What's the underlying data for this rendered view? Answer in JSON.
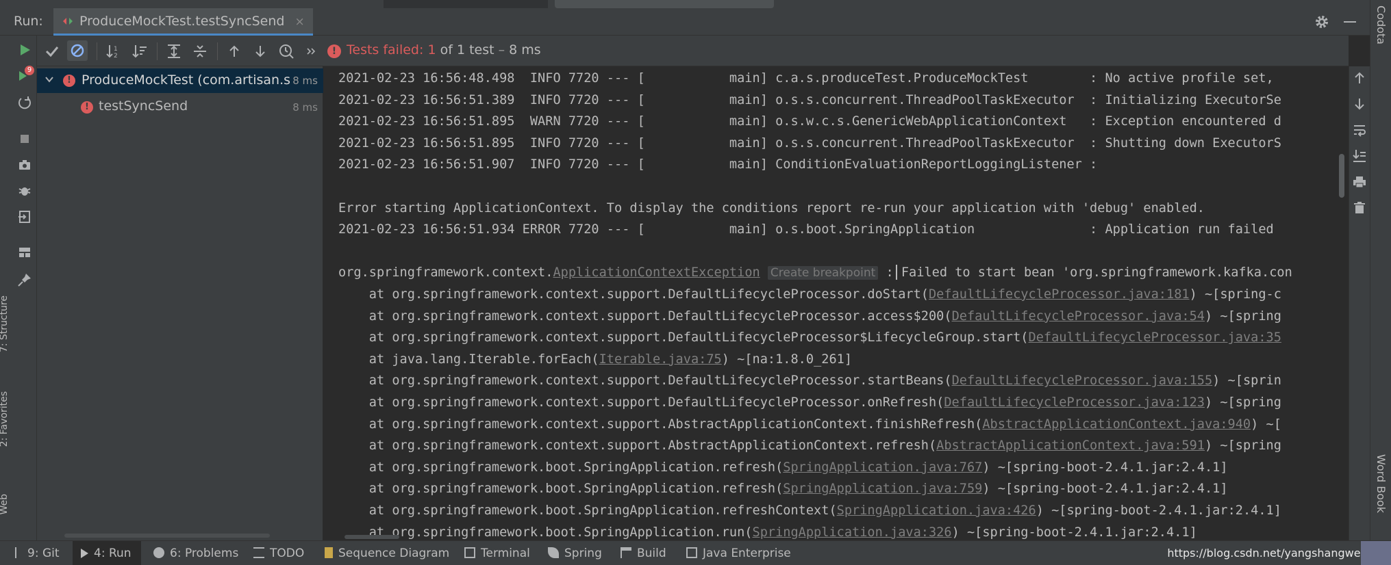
{
  "run_header": {
    "label": "Run:",
    "tab_title": "ProduceMockTest.testSyncSend",
    "tab_close": "×"
  },
  "side_labels": {
    "right_top": "Codota",
    "right_bottom": "Word Book",
    "left_structure": "7: Structure",
    "left_favorites": "2: Favorites",
    "left_web": "Web",
    "left_badge": "9"
  },
  "status": {
    "failed": "Tests failed:",
    "count": "1",
    "of_text": "of 1 test",
    "sep": "–",
    "time": "8 ms"
  },
  "tree": {
    "root_label": "ProduceMockTest (com.artisan.spring",
    "root_time": "8 ms",
    "child_label": "testSyncSend",
    "child_time": "8 ms"
  },
  "console_lines": [
    {
      "text": "2021-02-23 16:56:48.498  INFO 7720 --- [           main] c.a.s.produceTest.ProduceMockTest        : No active profile set,"
    },
    {
      "text": "2021-02-23 16:56:51.389  INFO 7720 --- [           main] o.s.s.concurrent.ThreadPoolTaskExecutor  : Initializing ExecutorSe"
    },
    {
      "text": "2021-02-23 16:56:51.895  WARN 7720 --- [           main] o.s.w.c.s.GenericWebApplicationContext   : Exception encountered d"
    },
    {
      "text": "2021-02-23 16:56:51.895  INFO 7720 --- [           main] o.s.s.concurrent.ThreadPoolTaskExecutor  : Shutting down ExecutorS"
    },
    {
      "text": "2021-02-23 16:56:51.907  INFO 7720 --- [           main] ConditionEvaluationReportLoggingListener :"
    },
    {
      "text": ""
    },
    {
      "text": "Error starting ApplicationContext. To display the conditions report re-run your application with 'debug' enabled."
    },
    {
      "text": "2021-02-23 16:56:51.934 ERROR 7720 --- [           main] o.s.boot.SpringApplication               : Application run failed"
    },
    {
      "text": ""
    },
    {
      "pre": "org.springframework.context.",
      "link": "ApplicationContextException",
      "hint": "Create breakpoint",
      "post": " : Failed to start bean 'org.springframework.kafka.con"
    },
    {
      "pre": "    at org.springframework.context.support.DefaultLifecycleProcessor.doStart(",
      "link": "DefaultLifecycleProcessor.java:181",
      "post": ") ~[spring-c"
    },
    {
      "pre": "    at org.springframework.context.support.DefaultLifecycleProcessor.access$200(",
      "link": "DefaultLifecycleProcessor.java:54",
      "post": ") ~[spring"
    },
    {
      "pre": "    at org.springframework.context.support.DefaultLifecycleProcessor$LifecycleGroup.start(",
      "link": "DefaultLifecycleProcessor.java:35",
      "post": ""
    },
    {
      "pre": "    at java.lang.Iterable.forEach(",
      "link": "Iterable.java:75",
      "post": ") ~[na:1.8.0_261]"
    },
    {
      "pre": "    at org.springframework.context.support.DefaultLifecycleProcessor.startBeans(",
      "link": "DefaultLifecycleProcessor.java:155",
      "post": ") ~[sprin"
    },
    {
      "pre": "    at org.springframework.context.support.DefaultLifecycleProcessor.onRefresh(",
      "link": "DefaultLifecycleProcessor.java:123",
      "post": ") ~[spring"
    },
    {
      "pre": "    at org.springframework.context.support.AbstractApplicationContext.finishRefresh(",
      "link": "AbstractApplicationContext.java:940",
      "post": ") ~["
    },
    {
      "pre": "    at org.springframework.context.support.AbstractApplicationContext.refresh(",
      "link": "AbstractApplicationContext.java:591",
      "post": ") ~[spring"
    },
    {
      "pre": "    at org.springframework.boot.SpringApplication.refresh(",
      "link": "SpringApplication.java:767",
      "post": ") ~[spring-boot-2.4.1.jar:2.4.1]"
    },
    {
      "pre": "    at org.springframework.boot.SpringApplication.refresh(",
      "link": "SpringApplication.java:759",
      "post": ") ~[spring-boot-2.4.1.jar:2.4.1]"
    },
    {
      "pre": "    at org.springframework.boot.SpringApplication.refreshContext(",
      "link": "SpringApplication.java:426",
      "post": ") ~[spring-boot-2.4.1.jar:2.4.1]"
    },
    {
      "pre": "    at org.springframework.boot.SpringApplication.run(",
      "link": "SpringApplication.java:326",
      "post": ") ~[spring-boot-2.4.1.jar:2.4.1]"
    }
  ],
  "bottom_bar": {
    "git": "9: Git",
    "run": "4: Run",
    "problems": "6: Problems",
    "todo": "TODO",
    "sequence": "Sequence Diagram",
    "terminal": "Terminal",
    "spring": "Spring",
    "build": "Build",
    "java_enterprise": "Java Enterprise",
    "watermark": "https://blog.csdn.net/yangshangwei"
  },
  "colors": {
    "error": "#db5c5c",
    "run_green": "#59a869",
    "selection": "#0d293e",
    "accent_blue": "#4a88c7"
  },
  "icons": [
    "run-icon",
    "check-icon",
    "stop-icon",
    "sort-alpha-icon",
    "sort-duration-icon",
    "expand-all-icon",
    "collapse-all-icon",
    "prev-failed-icon",
    "next-failed-icon",
    "history-icon",
    "more-icon",
    "gear-icon",
    "hide-icon",
    "rerun-failed-icon",
    "toggle-autotest-icon",
    "stop-square-icon",
    "camera-icon",
    "debug-icon",
    "export-icon",
    "layout-icon",
    "pin-icon",
    "up-arrow-icon",
    "down-arrow-icon",
    "soft-wrap-icon",
    "scroll-end-icon",
    "print-icon",
    "trash-icon"
  ]
}
